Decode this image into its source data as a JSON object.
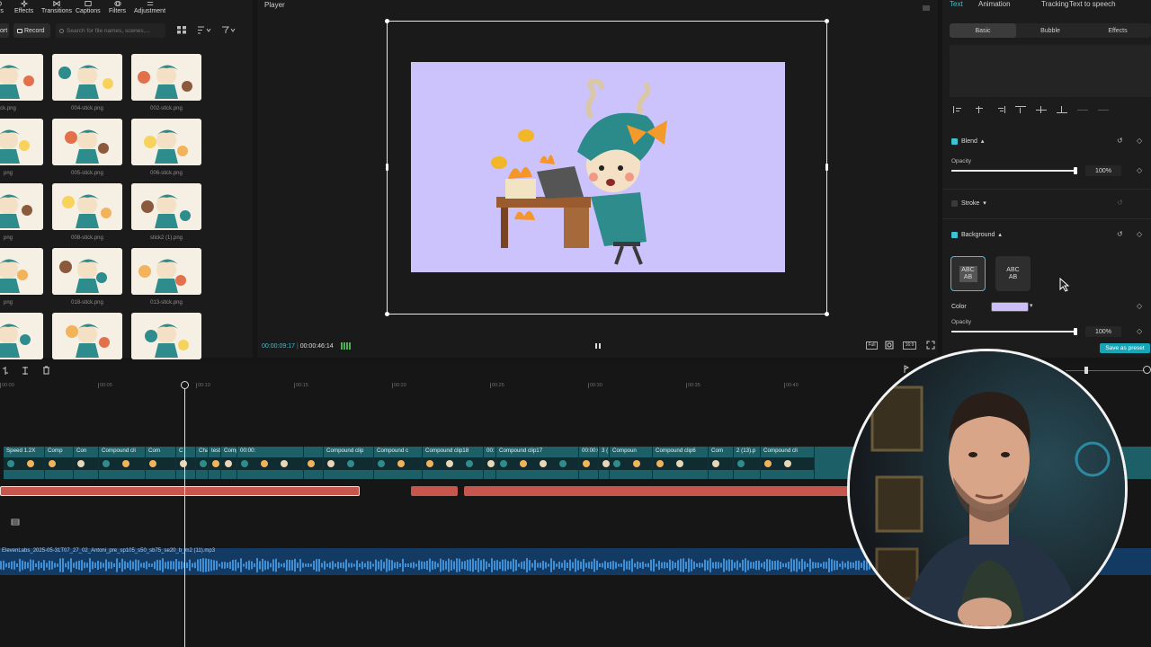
{
  "media_panel": {
    "toolbar": [
      "ers",
      "Effects",
      "Transitions",
      "Captions",
      "Filters",
      "Adjustment"
    ],
    "import_label": "ort",
    "record_label": "Record",
    "search_placeholder": "Search for file names, scenes,...",
    "files": [
      "ck.png",
      "004-stick.png",
      "002-stick.png",
      "png",
      "005-stick.png",
      "006-stick.png",
      "png",
      "008-stick.png",
      "stick2 (1).png",
      "png",
      "018-stick.png",
      "013-stick.png",
      "",
      "",
      ""
    ]
  },
  "player": {
    "title": "Player",
    "current_time": "00:00:09:17",
    "total_time": "00:00:46:14",
    "full_label": "Full",
    "ratio_label": "16:9",
    "canvas_color": "#ccc3fd"
  },
  "properties": {
    "tabs": [
      "Text",
      "Animation",
      "Tracking",
      "Text to speech"
    ],
    "active_tab": "Text",
    "subtabs": [
      "Basic",
      "Bubble",
      "Effects"
    ],
    "blend_label": "Blend",
    "opacity_label": "Opacity",
    "blend_opacity": "100%",
    "stroke_label": "Stroke",
    "background_label": "Background",
    "bg_option_1": "ABC AB",
    "bg_option_2": "ABC AB",
    "color_label": "Color",
    "bg_color": "#cbbef9",
    "bg_opacity_label": "Opacity",
    "bg_opacity": "100%",
    "save_preset": "Save as preset"
  },
  "timeline": {
    "ruler": [
      "00:00",
      "00:05",
      "00:10",
      "00:15",
      "00:20",
      "00:25",
      "00:30",
      "00:35",
      "00:40"
    ],
    "clips": [
      "Speed 1.2X",
      "Comp",
      "Con",
      "Compound cli",
      "Com",
      "C",
      "Cha",
      "test.p",
      "Compound clip25",
      "00:00:",
      "",
      "Compound clip",
      "Compound c",
      "Compound clip18",
      "00:",
      "Compound clip17",
      "00:00:04:2",
      "3 (",
      "Compoun",
      "Compound clip6",
      "Com",
      "2 (13).p",
      "Compound cli"
    ],
    "audio_name": "ElevenLabs_2025-05-31T07_27_02_Antoni_pre_sp105_s50_sb75_se20_b_m2 (11).mp3"
  }
}
